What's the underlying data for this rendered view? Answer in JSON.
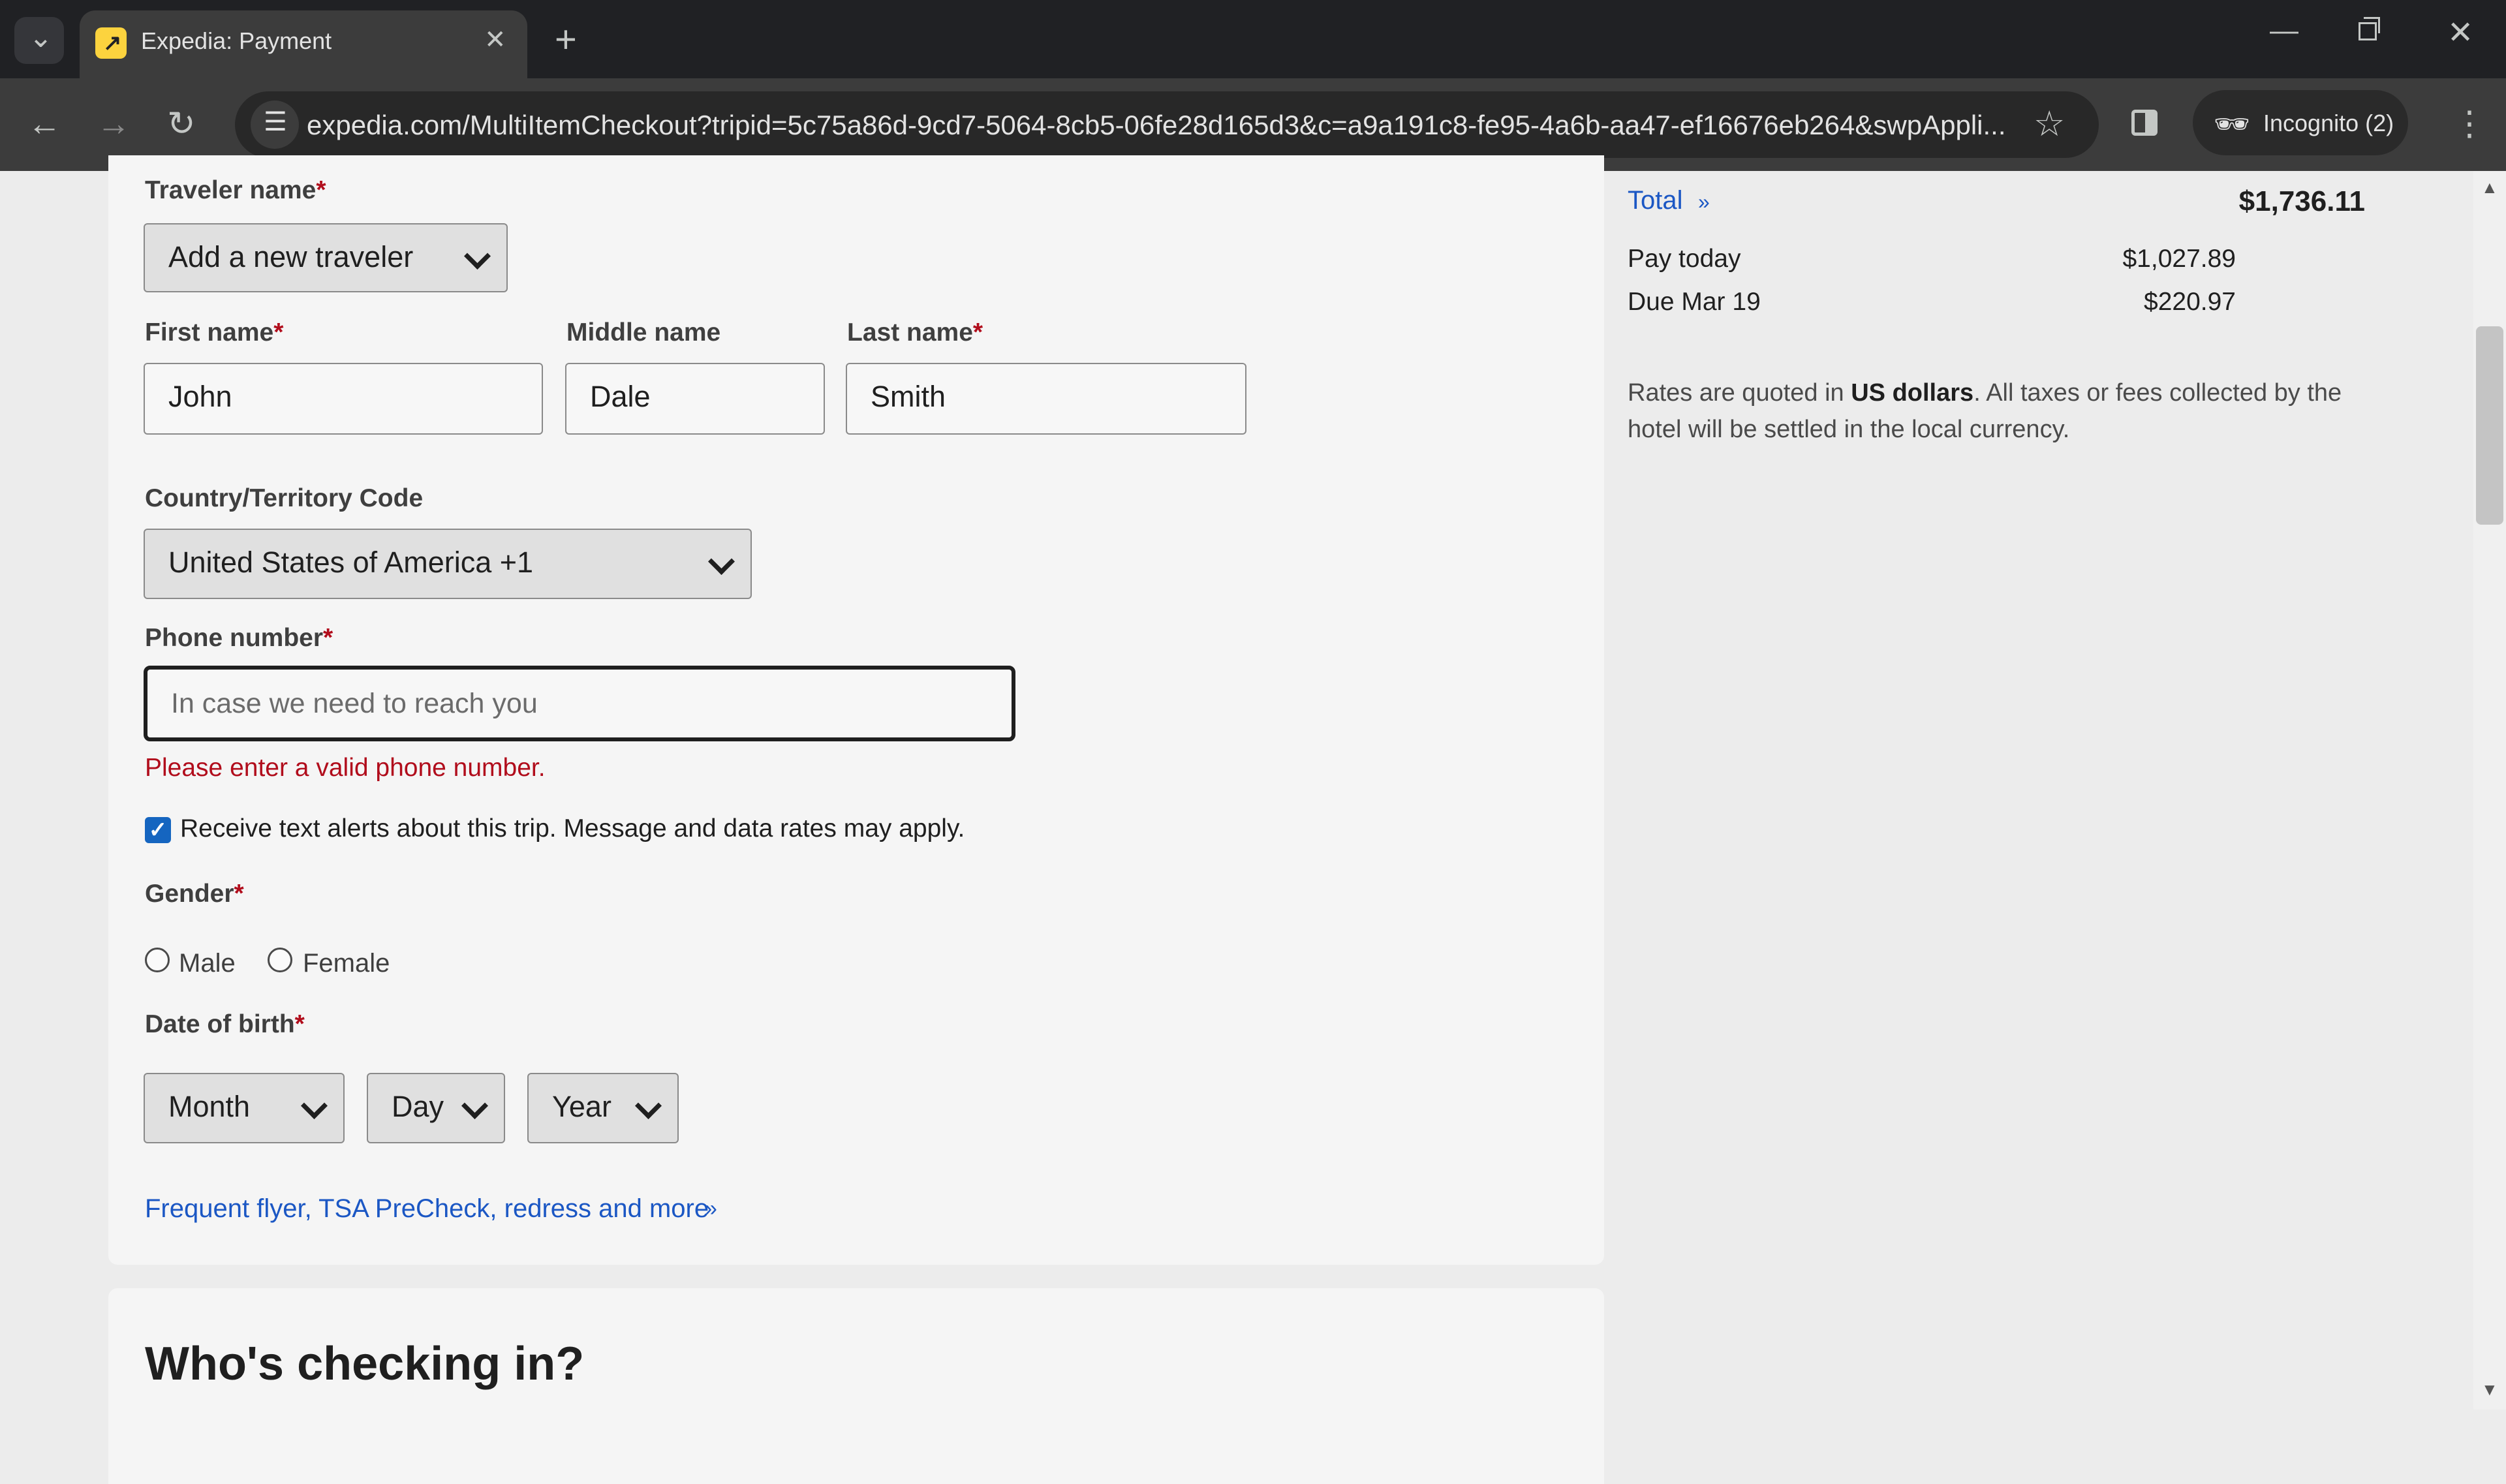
{
  "browser": {
    "tab_title": "Expedia: Payment",
    "url": "expedia.com/MultiItemCheckout?tripid=5c75a86d-9cd7-5064-8cb5-06fe28d165d3&c=a9a191c8-fe95-4a6b-aa47-ef16676eb264&swpAppli...",
    "incognito_label": "Incognito (2)",
    "glyphs": {
      "tab_search": "⌄",
      "close": "✕",
      "new_tab": "+",
      "back": "←",
      "forward": "→",
      "reload": "↻",
      "site_info": "☰",
      "star": "☆",
      "incognito": "🕶",
      "menu": "⋮",
      "minimize": "—",
      "win_close": "✕"
    }
  },
  "form": {
    "traveler_name_label": "Traveler name",
    "traveler_select": "Add a new traveler",
    "first_name_label": "First name",
    "first_name": "John",
    "middle_name_label": "Middle name",
    "middle_name": "Dale",
    "last_name_label": "Last name",
    "last_name": "Smith",
    "country_label": "Country/Territory Code",
    "country_value": "United States of America +1",
    "phone_label": "Phone number",
    "phone_placeholder": "In case we need to reach you",
    "phone_error": "Please enter a valid phone number.",
    "sms_checked": true,
    "sms_label": "Receive text alerts about this trip. Message and data rates may apply.",
    "gender_label": "Gender",
    "gender_options": [
      "Male",
      "Female"
    ],
    "dob_label": "Date of birth",
    "dob_month": "Month",
    "dob_day": "Day",
    "dob_year": "Year",
    "required_mark": "*",
    "more_link": "Frequent flyer, TSA PreCheck, redress and more"
  },
  "next_section": {
    "title": "Who's checking in?"
  },
  "summary": {
    "total_label": "Total",
    "total_amount": "$1,736.11",
    "pay_today_label": "Pay today",
    "pay_today_amount": "$1,027.89",
    "due_label": "Due Mar 19",
    "due_amount": "$220.97",
    "rates_prefix": "Rates are quoted in ",
    "rates_bold": "US dollars",
    "rates_suffix": ". All taxes or fees collected by the hotel will be settled in the local currency."
  },
  "colors": {
    "link": "#1b57c4",
    "error": "#b10d1c",
    "checkbox": "#1565c0",
    "brand_favicon": "#fcd33e"
  }
}
